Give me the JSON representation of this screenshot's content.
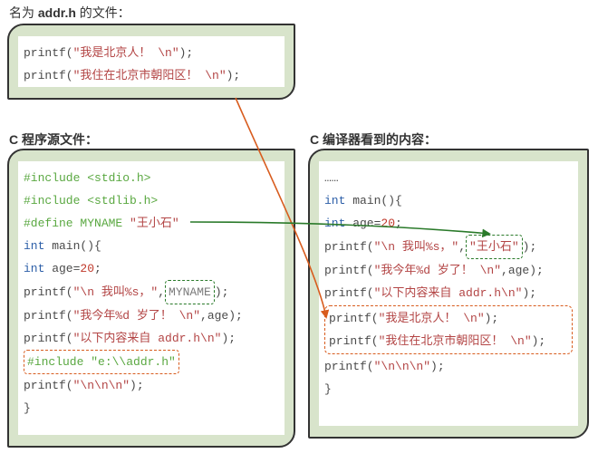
{
  "labels": {
    "addr_title_prefix": "名为 ",
    "addr_title_bold": "addr.h",
    "addr_title_suffix": " 的文件：",
    "src_title": "C 程序源文件：",
    "compiled_title": "C 编译器看到的内容："
  },
  "addr_code": {
    "line1_a": "printf(",
    "line1_b": "\"我是北京人！ \\n\"",
    "line1_c": ");",
    "line2_a": "printf(",
    "line2_b": "\"我住在北京市朝阳区！ \\n\"",
    "line2_c": ");"
  },
  "src_code": {
    "inc1": "#include <stdio.h>",
    "inc2": "#include <stdlib.h>",
    "def_a": "#define MYNAME ",
    "def_b": "\"王小石\"",
    "main_a": "int",
    "main_b": " main(){",
    "age_a": "int",
    "age_b": " age=",
    "age_c": "20",
    "age_d": ";",
    "p1_a": "printf(",
    "p1_b": "\"\\n 我叫%s，\"",
    "p1_c": ",",
    "p1_d": "MYNAME",
    "p1_e": ");",
    "p2_a": "printf(",
    "p2_b": "\"我今年%d 岁了！ \\n\"",
    "p2_c": ",age);",
    "p3_a": "printf(",
    "p3_b": "\"以下内容来自 addr.h\\n\"",
    "p3_c": ");",
    "inc3": "#include \"e:\\\\addr.h\"",
    "p4_a": "printf(",
    "p4_b": "\"\\n\\n\\n\"",
    "p4_c": ");",
    "brace": "}"
  },
  "compiled_code": {
    "dots": "……",
    "main_a": "int",
    "main_b": " main(){",
    "age_a": "int",
    "age_b": " age=",
    "age_c": "20",
    "age_d": ";",
    "p1_a": "printf(",
    "p1_b": "\"\\n 我叫%s，\"",
    "p1_c": ",",
    "p1_d": "\"王小石\"",
    "p1_e": ");",
    "p2_a": "printf(",
    "p2_b": "\"我今年%d 岁了！ \\n\"",
    "p2_c": ",age);",
    "p3_a": "printf(",
    "p3_b": "\"以下内容来自 addr.h\\n\"",
    "p3_c": ");",
    "p4_a": "printf(",
    "p4_b": "\"我是北京人！ \\n\"",
    "p4_c": ");",
    "p5_a": "printf(",
    "p5_b": "\"我住在北京市朝阳区！ \\n\"",
    "p5_c": ");",
    "p6_a": "printf(",
    "p6_b": "\"\\n\\n\\n\"",
    "p6_c": ");",
    "brace": "}"
  },
  "chart_data": {
    "type": "diagram",
    "description": "C preprocessor substitution diagram",
    "arrows": [
      {
        "from": "addr.h file content",
        "to": "compiled output inserted lines",
        "color": "#d85c1e",
        "meaning": "#include \"e:\\\\addr.h\" expansion"
      },
      {
        "from": "#define MYNAME \"王小石\"",
        "to": "\"王小石\" literal in compiled printf",
        "color": "#2a7a2a",
        "meaning": "macro substitution"
      }
    ]
  }
}
